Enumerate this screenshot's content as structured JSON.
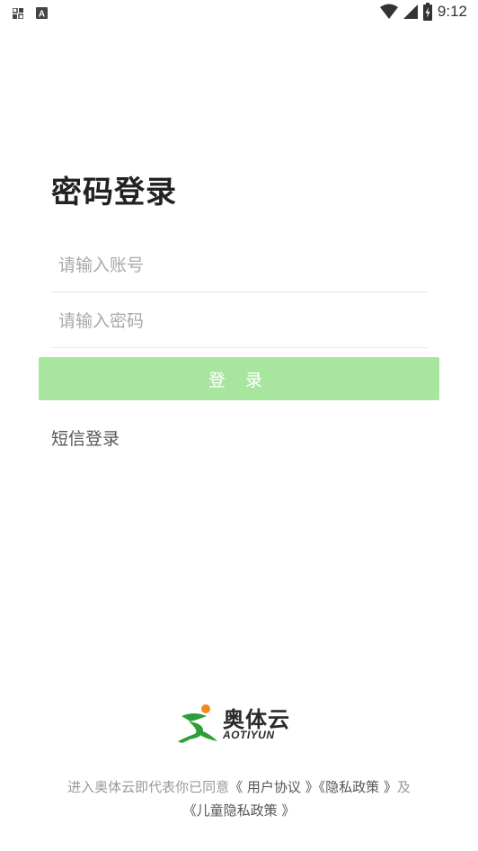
{
  "status_bar": {
    "time": "9:12",
    "icons": [
      "notification-icon",
      "a-icon",
      "wifi-icon",
      "signal-icon",
      "battery-charging-icon"
    ]
  },
  "login": {
    "title": "密码登录",
    "account_placeholder": "请输入账号",
    "password_placeholder": "请输入密码",
    "login_button": "登 录",
    "sms_login": "短信登录"
  },
  "brand": {
    "name_cn": "奥体云",
    "name_en": "AOTIYUN",
    "colors": {
      "green": "#2e9e3a",
      "orange": "#f28a1c"
    }
  },
  "agreement": {
    "prefix": "进入奥体云即代表你已同意",
    "user_agreement": "《 用户协议 》",
    "privacy_policy": "《隐私政策 》",
    "and": "及",
    "children_privacy": "《儿童隐私政策 》"
  },
  "colors": {
    "button_bg": "#a8e6a0",
    "divider": "#e6e6e6"
  }
}
